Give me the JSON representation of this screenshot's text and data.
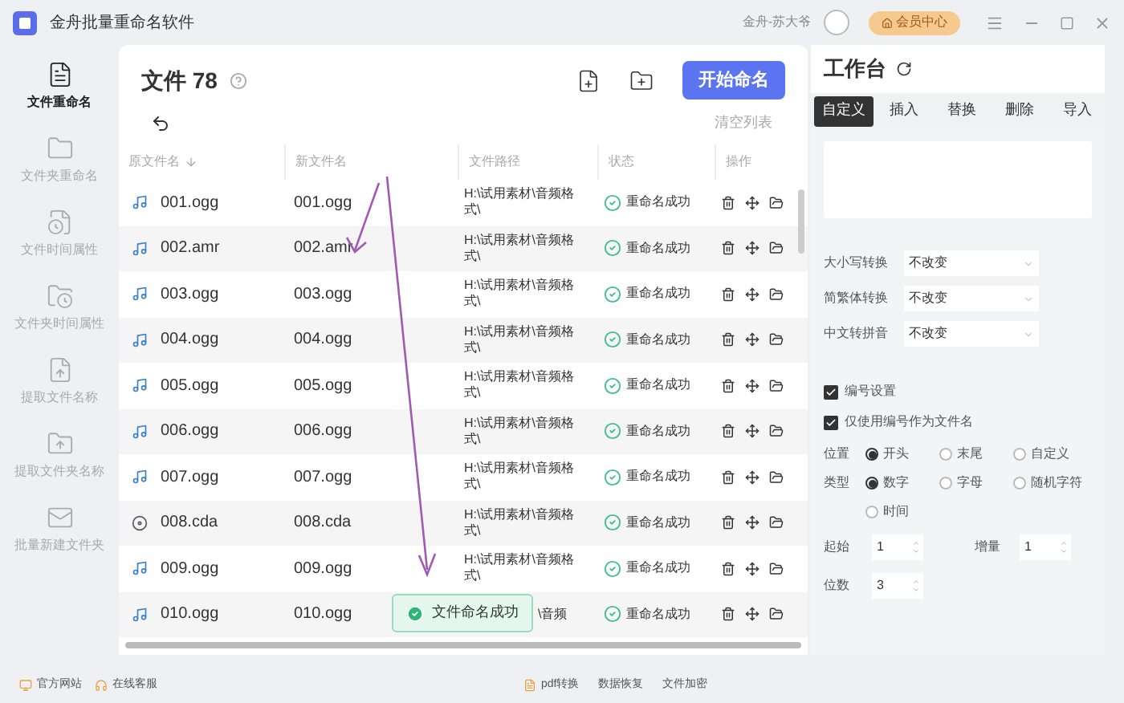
{
  "window": {
    "title": "金舟批量重命名软件",
    "user": "金舟-苏大爷",
    "vip": "会员中心"
  },
  "sidebar": {
    "items": [
      {
        "label": "文件重命名",
        "selected": true,
        "kind": "file"
      },
      {
        "label": "文件夹重命名",
        "selected": false,
        "kind": "folder"
      },
      {
        "label": "文件时间属性",
        "selected": false,
        "kind": "file-clock"
      },
      {
        "label": "文件夹时间属性",
        "selected": false,
        "kind": "folder-clock"
      },
      {
        "label": "提取文件名称",
        "selected": false,
        "kind": "file-up"
      },
      {
        "label": "提取文件夹名称",
        "selected": false,
        "kind": "folder-up"
      },
      {
        "label": "批量新建文件夹",
        "selected": false,
        "kind": "mail"
      }
    ]
  },
  "files": {
    "title": "文件 78",
    "start_button": "开始命名",
    "clear": "清空列表",
    "columns": [
      "原文件名",
      "新文件名",
      "文件路径",
      "状态",
      "操作"
    ],
    "rows": [
      {
        "original": "001.ogg",
        "new": "001.ogg",
        "path": "H:\\试用素材\\音频格式\\",
        "status": "重命名成功",
        "kind": "audio"
      },
      {
        "original": "002.amr",
        "new": "002.amr",
        "path": "H:\\试用素材\\音频格式\\",
        "status": "重命名成功",
        "kind": "audio"
      },
      {
        "original": "003.ogg",
        "new": "003.ogg",
        "path": "H:\\试用素材\\音频格式\\",
        "status": "重命名成功",
        "kind": "audio"
      },
      {
        "original": "004.ogg",
        "new": "004.ogg",
        "path": "H:\\试用素材\\音频格式\\",
        "status": "重命名成功",
        "kind": "audio"
      },
      {
        "original": "005.ogg",
        "new": "005.ogg",
        "path": "H:\\试用素材\\音频格式\\",
        "status": "重命名成功",
        "kind": "audio"
      },
      {
        "original": "006.ogg",
        "new": "006.ogg",
        "path": "H:\\试用素材\\音频格式\\",
        "status": "重命名成功",
        "kind": "audio"
      },
      {
        "original": "007.ogg",
        "new": "007.ogg",
        "path": "H:\\试用素材\\音频格式\\",
        "status": "重命名成功",
        "kind": "audio"
      },
      {
        "original": "008.cda",
        "new": "008.cda",
        "path": "H:\\试用素材\\音频格式\\",
        "status": "重命名成功",
        "kind": "disc"
      },
      {
        "original": "009.ogg",
        "new": "009.ogg",
        "path": "H:\\试用素材\\音频格式\\",
        "status": "重命名成功",
        "kind": "audio"
      },
      {
        "original": "010.ogg",
        "new": "010.ogg",
        "path": "\\音频",
        "status": "重命名成功",
        "kind": "audio"
      }
    ],
    "toast": "文件命名成功"
  },
  "workbench": {
    "title": "工作台",
    "tabs": [
      {
        "label": "自定义",
        "selected": true
      },
      {
        "label": "插入",
        "selected": false
      },
      {
        "label": "替换",
        "selected": false
      },
      {
        "label": "删除",
        "selected": false
      },
      {
        "label": "导入",
        "selected": false
      }
    ],
    "dropdowns": [
      {
        "label": "大小写转换",
        "value": "不改变"
      },
      {
        "label": "简繁体转换",
        "value": "不改变"
      },
      {
        "label": "中文转拼音",
        "value": "不改变"
      }
    ],
    "checkboxes": [
      {
        "label": "编号设置",
        "checked": true
      },
      {
        "label": "仅使用编号作为文件名",
        "checked": true
      }
    ],
    "radio_groups": [
      {
        "label": "位置",
        "options": [
          {
            "label": "开头",
            "selected": true
          },
          {
            "label": "末尾",
            "selected": false
          },
          {
            "label": "自定义",
            "selected": false
          }
        ]
      },
      {
        "label": "类型",
        "options": [
          {
            "label": "数字",
            "selected": true
          },
          {
            "label": "字母",
            "selected": false
          },
          {
            "label": "随机字符",
            "selected": false
          },
          {
            "label": "时间",
            "selected": false
          }
        ]
      }
    ],
    "spinners": [
      {
        "label": "起始",
        "value": "1"
      },
      {
        "label": "增量",
        "value": "1"
      },
      {
        "label": "位数",
        "value": "3"
      }
    ]
  },
  "footer": {
    "left": [
      "官方网站",
      "在线客服"
    ],
    "right": [
      "pdf转换",
      "数据恢复",
      "文件加密"
    ]
  }
}
